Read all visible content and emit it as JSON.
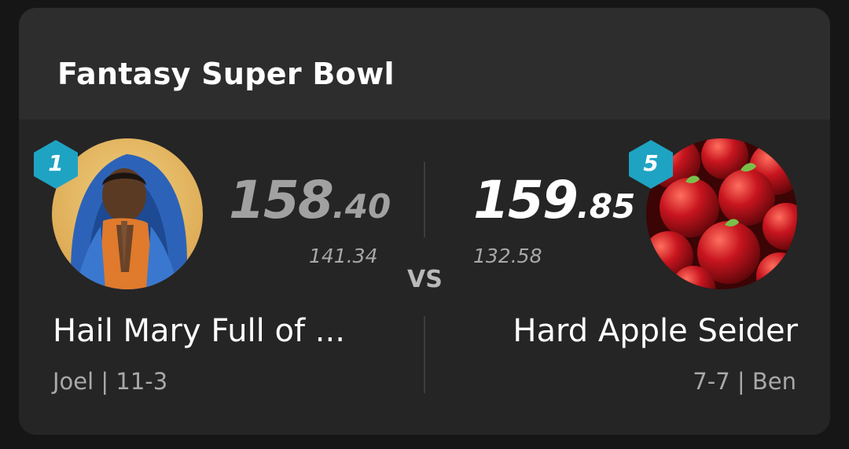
{
  "card": {
    "title": "Fantasy Super Bowl"
  },
  "matchup": {
    "vs_label": "VS",
    "left_team": {
      "seed": "1",
      "score_int": "158",
      "score_dec": ".40",
      "projection": "141.34",
      "name": "Hail Mary Full of ...",
      "owner_record": "Joel | 11-3",
      "avatar_icon": "praying-figure-avatar"
    },
    "right_team": {
      "seed": "5",
      "score_int": "159",
      "score_dec": ".85",
      "projection": "132.58",
      "name": "Hard Apple Seider",
      "owner_record": "7-7 | Ben",
      "avatar_icon": "apples-avatar"
    }
  },
  "colors": {
    "background": "#161616",
    "card": "#252525",
    "header": "#2d2d2d",
    "seed_badge": "#1fa3c3",
    "leading_score": "#ffffff",
    "trailing_score": "#a1a1a1",
    "muted_text": "#a9a9a9"
  }
}
